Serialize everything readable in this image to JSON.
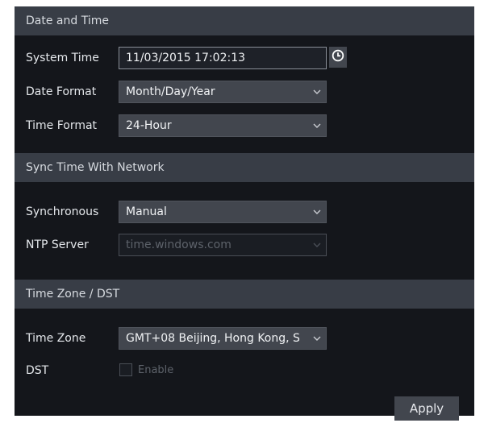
{
  "sections": {
    "date_time": {
      "title": "Date and Time",
      "system_time_label": "System Time",
      "system_time_value": "11/03/2015 17:02:13",
      "date_format_label": "Date Format",
      "date_format_value": "Month/Day/Year",
      "time_format_label": "Time Format",
      "time_format_value": "24-Hour"
    },
    "sync": {
      "title": "Sync Time With Network",
      "synchronous_label": "Synchronous",
      "synchronous_value": "Manual",
      "ntp_server_label": "NTP Server",
      "ntp_server_value": "time.windows.com"
    },
    "timezone": {
      "title": "Time Zone / DST",
      "time_zone_label": "Time Zone",
      "time_zone_value": "GMT+08 Beijing, Hong Kong, S",
      "dst_label": "DST",
      "dst_enable_label": "Enable",
      "dst_enabled": false
    }
  },
  "apply_label": "Apply",
  "icons": {
    "clock": "clock-icon",
    "dropdown": "chevron-down-icon"
  },
  "colors": {
    "panel_background": "#14161b",
    "section_header": "#383d46",
    "control": "#42464e"
  }
}
